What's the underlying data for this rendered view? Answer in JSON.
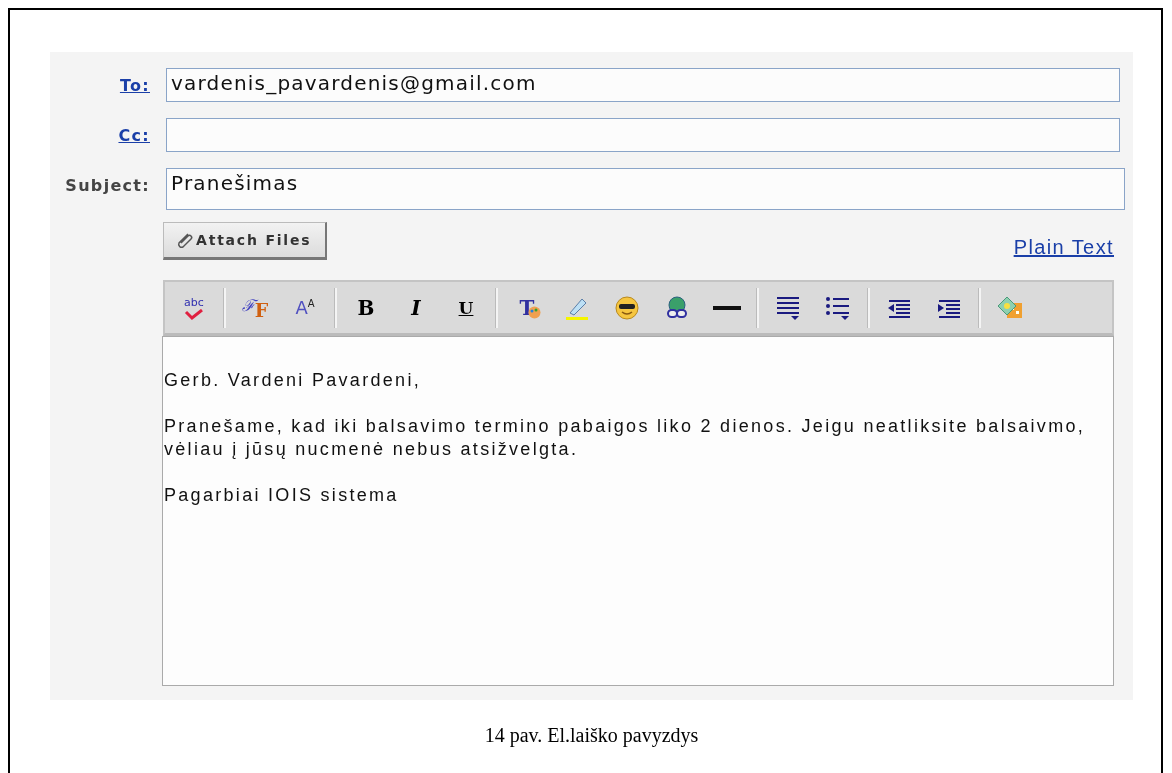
{
  "compose": {
    "fields": [
      {
        "label": "To:",
        "kind": "link",
        "value": "vardenis_pavardenis@gmail.com"
      },
      {
        "label": "Cc:",
        "kind": "link"
      },
      {
        "label": "Subject:",
        "kind": "plain",
        "value": "Pranešimas"
      }
    ],
    "attach_button": "Attach Files",
    "plain_text_link": "Plain Text",
    "toolbar": [
      {
        "kind": "spellcheck",
        "glyph": "abc"
      },
      {
        "kind": "separator"
      },
      {
        "kind": "font",
        "glyph": "ℱ$_{F}$"
      },
      {
        "kind": "size",
        "glyph": "A$^{A}$"
      },
      {
        "kind": "separator"
      },
      {
        "kind": "bold",
        "glyph": "B"
      },
      {
        "kind": "italic",
        "glyph": "I"
      },
      {
        "kind": "underline",
        "glyph": "U"
      },
      {
        "kind": "separator"
      },
      {
        "kind": "textcolor",
        "glyph": "T"
      },
      {
        "kind": "highlight"
      },
      {
        "kind": "emoticon"
      },
      {
        "kind": "link"
      },
      {
        "kind": "rule"
      },
      {
        "kind": "separator"
      },
      {
        "kind": "align"
      },
      {
        "kind": "bullets"
      },
      {
        "kind": "separator"
      },
      {
        "kind": "outdent"
      },
      {
        "kind": "indent"
      },
      {
        "kind": "separator"
      },
      {
        "kind": "image"
      }
    ],
    "body": [
      "Gerb. Vardeni Pavardeni,",
      "Pranešame, kad iki balsavimo termino pabaigos liko 2 dienos. Jeigu neatliksite balsaivmo, vėliau į jūsų nucmenė nebus atsižvelgta.",
      "Pagarbiai IOIS sistema"
    ]
  },
  "caption": "14 pav. El.laiško pavyzdys"
}
